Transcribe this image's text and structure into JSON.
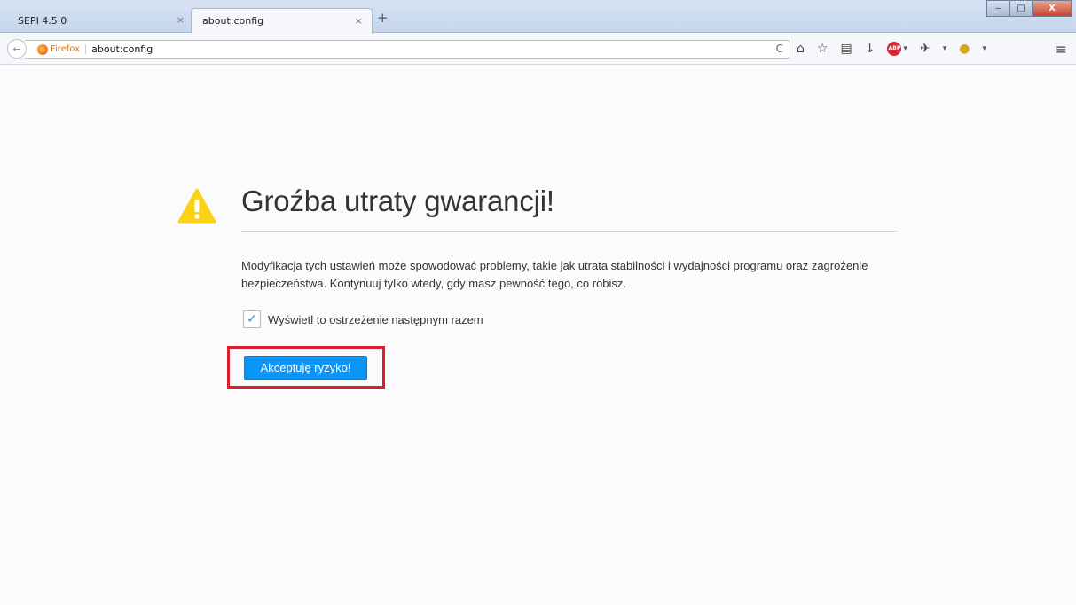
{
  "tabs": [
    {
      "label": "SEPI 4.5.0",
      "close": "×"
    },
    {
      "label": "about:config",
      "close": "×"
    }
  ],
  "new_tab": "+",
  "window_controls": {
    "minimize": "‒",
    "maximize": "□",
    "close": "X"
  },
  "navbar": {
    "back": "←",
    "identity_label": "Firefox",
    "url": "about:config",
    "reload": "C",
    "icons": [
      "home-icon",
      "bookmark-star-icon",
      "reading-list-icon",
      "download-icon",
      "adblock-icon",
      "extension-icon",
      "user-icon",
      "menu-icon"
    ],
    "adblock_label": "ABP",
    "home": "⌂",
    "star": "☆",
    "reading": "▤",
    "download": "↓",
    "dropdown": "▾",
    "extension": "✈",
    "user": "●",
    "menu": "≡"
  },
  "colors": {
    "accent": "#0996f8",
    "warning": "#fcd116",
    "highlight": "#d9202f"
  },
  "warning": {
    "title": "Groźba utraty gwarancji!",
    "description": "Modyfikacja tych ustawień może spowodować problemy, takie jak utrata stabilności i wydajności programu oraz zagrożenie bezpieczeństwa. Kontynuuj tylko wtedy, gdy masz pewność tego, co robisz.",
    "checkbox_label": "Wyświetl to ostrzeżenie następnym razem",
    "checkbox_mark": "✓",
    "checkbox_checked": true,
    "accept_button": "Akceptuję ryzyko!"
  }
}
